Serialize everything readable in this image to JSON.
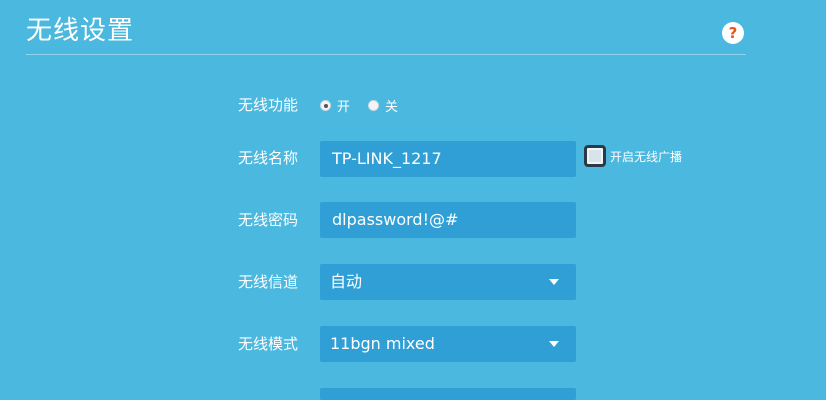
{
  "page": {
    "title": "无线设置",
    "help_glyph": "?"
  },
  "wireless_function": {
    "label": "无线功能",
    "options": [
      {
        "label": "开",
        "checked": true
      },
      {
        "label": "关",
        "checked": false
      }
    ]
  },
  "ssid": {
    "label": "无线名称",
    "value": "TP-LINK_1217",
    "broadcast_label": "开启无线广播",
    "broadcast_checked": false
  },
  "password": {
    "label": "无线密码",
    "value": "dlpassword!@#"
  },
  "channel": {
    "label": "无线信道",
    "value": "自动"
  },
  "mode": {
    "label": "无线模式",
    "value": "11bgn mixed"
  },
  "colors": {
    "background": "#4ab8df",
    "field": "#2f9fd6",
    "help_icon": "#e8541e"
  },
  "icons": [
    "help-icon",
    "chevron-down-icon",
    "radio-icon",
    "checkbox-icon"
  ]
}
